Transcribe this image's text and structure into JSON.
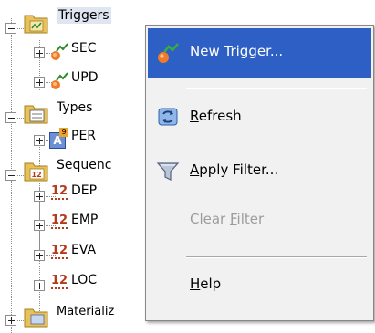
{
  "tree": {
    "triggers": {
      "label": "Triggers",
      "children": [
        "SEC",
        "UPD"
      ]
    },
    "types": {
      "label": "Types",
      "children": [
        "PER"
      ]
    },
    "sequences": {
      "label": "Sequenc",
      "children": [
        "DEP",
        "EMP",
        "EVA",
        "LOC"
      ]
    },
    "materialized": {
      "label": "Materializ"
    },
    "sequence_icon_text": "12",
    "type_icon_text": "A",
    "type_icon_sup": "9"
  },
  "context_menu": {
    "items": [
      {
        "pre": "New ",
        "mnemonic": "T",
        "post": "rigger...",
        "icon": "new-trigger-icon",
        "state": "highlighted"
      },
      {
        "pre": "",
        "mnemonic": "R",
        "post": "efresh",
        "icon": "refresh-icon",
        "state": "enabled"
      },
      {
        "pre": "",
        "mnemonic": "A",
        "post": "pply Filter...",
        "icon": "filter-funnel-icon",
        "state": "enabled"
      },
      {
        "pre": "Clear ",
        "mnemonic": "F",
        "post": "ilter",
        "icon": "",
        "state": "disabled"
      },
      {
        "pre": "",
        "mnemonic": "H",
        "post": "elp",
        "icon": "",
        "state": "enabled"
      }
    ]
  },
  "colors": {
    "highlight": "#2e5fc4",
    "menu_bg": "#f1f1f1",
    "folder": "#e8c15a",
    "disabled_text": "#9c9c9c"
  }
}
